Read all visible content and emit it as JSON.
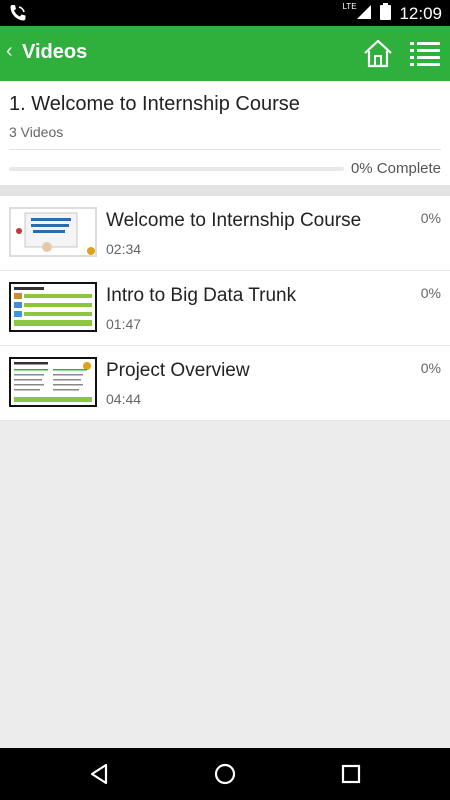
{
  "status_bar": {
    "time": "12:09",
    "network": "LTE"
  },
  "app_bar": {
    "title": "Videos"
  },
  "course": {
    "title": "1. Welcome to Internship Course",
    "video_count": "3 Videos",
    "progress_fraction": 0,
    "progress_label": "0% Complete"
  },
  "videos": [
    {
      "title": "Welcome to Internship Course",
      "duration": "02:34",
      "percent": "0%"
    },
    {
      "title": "Intro to Big Data Trunk",
      "duration": "01:47",
      "percent": "0%"
    },
    {
      "title": "Project Overview",
      "duration": "04:44",
      "percent": "0%"
    }
  ],
  "colors": {
    "accent": "#2fb03c",
    "status_bar": "#000000",
    "nav_bar": "#000000"
  }
}
